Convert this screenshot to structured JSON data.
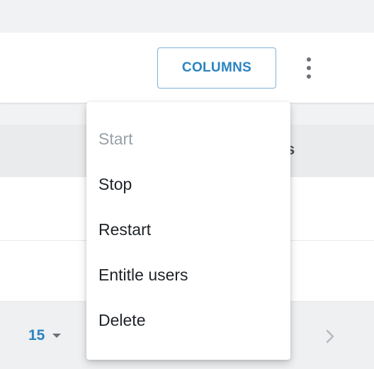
{
  "toolbar": {
    "columns_label": "COLUMNS",
    "more_icon": "more-vertical-icon"
  },
  "table": {
    "header_fragment": "s"
  },
  "pagination": {
    "rows_per_page": "15",
    "dropdown_icon": "caret-down-icon",
    "next_icon": "chevron-right-icon"
  },
  "menu": {
    "items": [
      {
        "label": "Start",
        "disabled": true
      },
      {
        "label": "Stop",
        "disabled": false
      },
      {
        "label": "Restart",
        "disabled": false
      },
      {
        "label": "Entitle users",
        "disabled": false
      },
      {
        "label": "Delete",
        "disabled": false
      }
    ]
  },
  "colors": {
    "accent": "#2b84c0",
    "disabled_text": "#9aa0a6",
    "background": "#f1f2f3"
  }
}
